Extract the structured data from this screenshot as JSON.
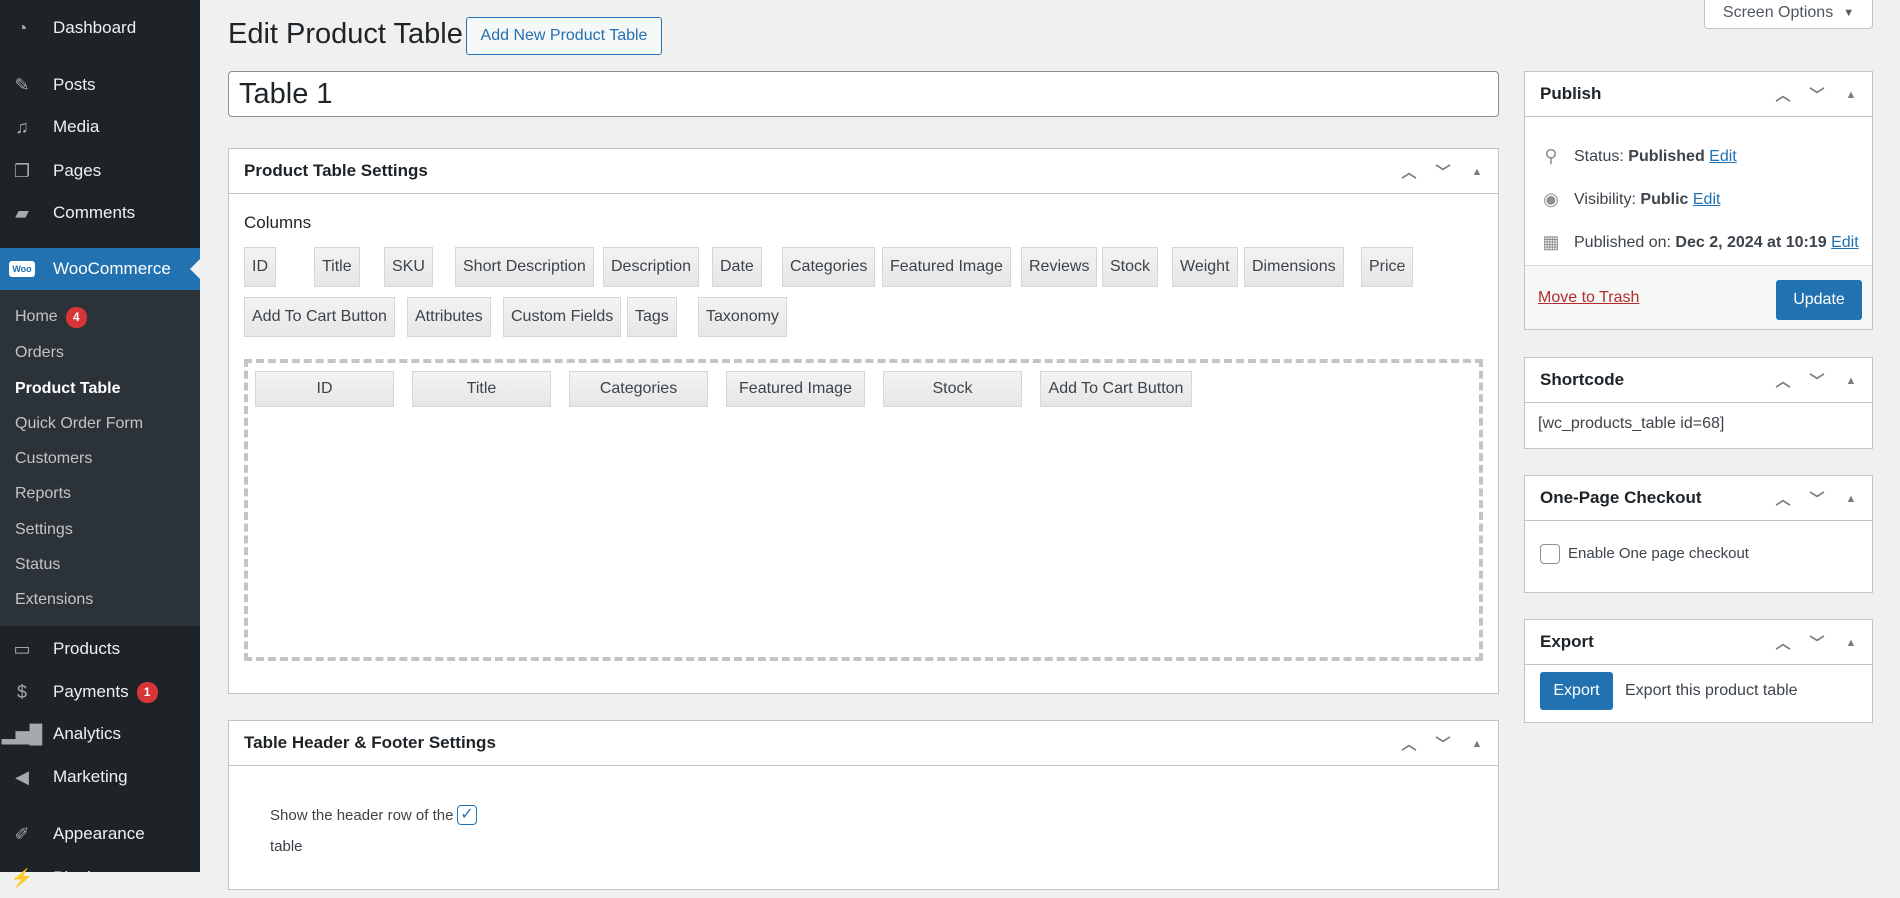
{
  "sidebar": {
    "top": [
      {
        "label": "Dashboard",
        "icon": "dashboard-icon"
      },
      {
        "label": "Posts",
        "icon": "pin-icon"
      },
      {
        "label": "Media",
        "icon": "media-icon"
      },
      {
        "label": "Pages",
        "icon": "pages-icon"
      },
      {
        "label": "Comments",
        "icon": "comment-icon"
      }
    ],
    "woocommerce": {
      "label": "WooCommerce",
      "logo": "Woo"
    },
    "sub": [
      {
        "label": "Home",
        "badge": "4"
      },
      {
        "label": "Orders"
      },
      {
        "label": "Product Table"
      },
      {
        "label": "Quick Order Form"
      },
      {
        "label": "Customers"
      },
      {
        "label": "Reports"
      },
      {
        "label": "Settings"
      },
      {
        "label": "Status"
      },
      {
        "label": "Extensions"
      }
    ],
    "bottom": [
      {
        "label": "Products"
      },
      {
        "label": "Payments",
        "badge": "1"
      },
      {
        "label": "Analytics"
      },
      {
        "label": "Marketing"
      },
      {
        "label": "Appearance"
      },
      {
        "label": "Plugins"
      }
    ]
  },
  "header": {
    "title": "Edit Product Table",
    "add_new": "Add New Product Table",
    "screen_options": "Screen Options"
  },
  "title_input": "Table 1",
  "settings": {
    "title": "Product Table Settings",
    "columns_label": "Columns",
    "available": [
      "ID",
      "Title",
      "SKU",
      "Short Description",
      "Description",
      "Date",
      "Categories",
      "Featured Image",
      "Reviews",
      "Stock",
      "Weight",
      "Dimensions",
      "Price",
      "Add To Cart Button",
      "Attributes",
      "Custom Fields",
      "Tags",
      "Taxonomy"
    ],
    "selected": [
      "ID",
      "Title",
      "Categories",
      "Featured Image",
      "Stock",
      "Add To Cart Button"
    ]
  },
  "header_footer": {
    "title": "Table Header & Footer Settings",
    "show_header_label_1": "Show the header row of the",
    "show_header_label_2": "table",
    "show_header_checked": true
  },
  "publish": {
    "title": "Publish",
    "status_label": "Status:",
    "status": "Published",
    "visibility_label": "Visibility:",
    "visibility": "Public",
    "published_label": "Published on:",
    "published": "Dec 2, 2024 at 10:19",
    "edit": "Edit",
    "trash": "Move to Trash",
    "update": "Update"
  },
  "shortcode": {
    "title": "Shortcode",
    "value": "[wc_products_table id=68]"
  },
  "one_page": {
    "title": "One-Page Checkout",
    "checkbox_label": "Enable One page checkout",
    "checked": false
  },
  "export": {
    "title": "Export",
    "button": "Export",
    "description": "Export this product table"
  }
}
